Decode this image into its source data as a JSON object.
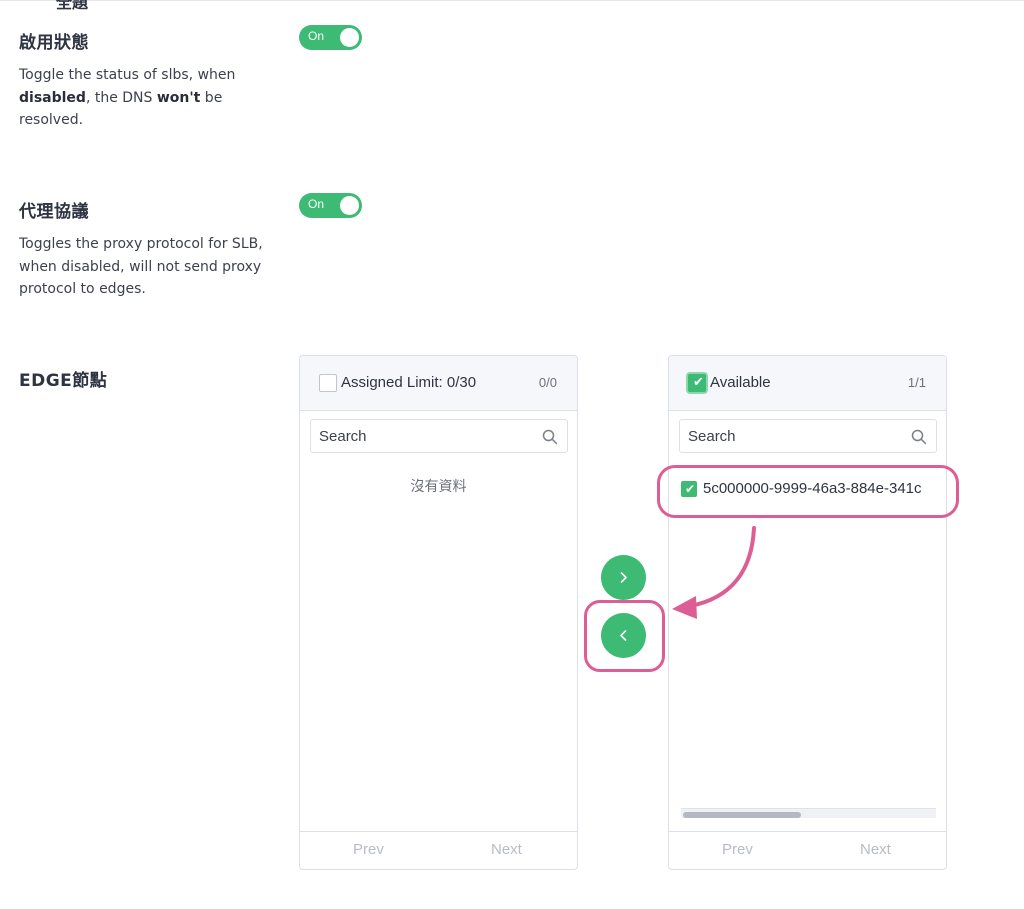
{
  "header_partial_title": "全題",
  "status_section": {
    "title": "啟用狀態",
    "desc_part1": "Toggle the status of slbs, when ",
    "desc_bold1": "disabled",
    "desc_part2": ", the DNS ",
    "desc_bold2": "won't",
    "desc_part3": " be resolved.",
    "toggle_label": "On",
    "toggle_on": true
  },
  "proxy_section": {
    "title": "代理協議",
    "desc": "Toggles the proxy protocol for SLB, when disabled, will not send proxy protocol to edges.",
    "toggle_label": "On",
    "toggle_on": true
  },
  "edge_section": {
    "title": "EDGE節點"
  },
  "left_panel": {
    "title": "Assigned Limit: 0/30",
    "count": "0/0",
    "search_placeholder": "Search",
    "empty_text": "沒有資料",
    "prev_label": "Prev",
    "next_label": "Next"
  },
  "right_panel": {
    "title": "Available",
    "count": "1/1",
    "search_placeholder": "Search",
    "items": [
      "5c000000-9999-46a3-884e-341c"
    ],
    "prev_label": "Prev",
    "next_label": "Next"
  },
  "icons": {
    "search": "search-icon",
    "move_right": "chevron-right-icon",
    "move_left": "chevron-left-icon",
    "check": "check-icon"
  },
  "colors": {
    "accent_green": "#3dba73",
    "highlight_pink": "#dc5e94"
  }
}
